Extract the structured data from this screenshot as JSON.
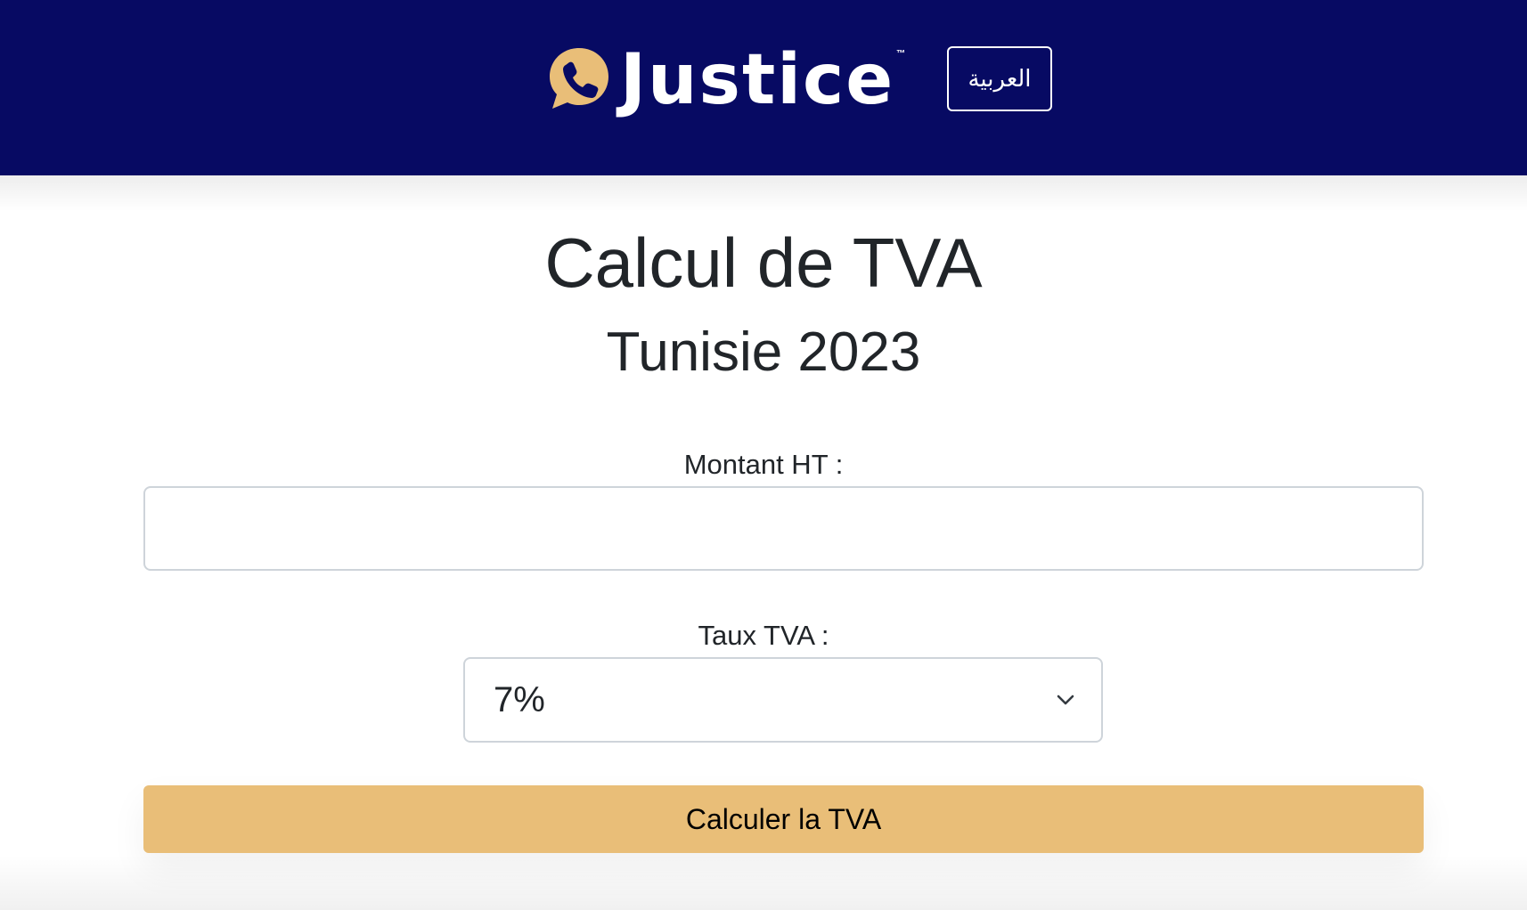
{
  "header": {
    "brand_name": "Justice",
    "trademark": "™",
    "language_button": "العربية",
    "colors": {
      "background": "#070a63",
      "logo_accent": "#e9be78",
      "text": "#ffffff"
    }
  },
  "main": {
    "title": "Calcul de TVA",
    "subtitle": "Tunisie 2023",
    "amount_label": "Montant HT :",
    "amount_value": "",
    "amount_placeholder": "",
    "rate_label": "Taux TVA :",
    "rate_selected": "7%",
    "submit_label": "Calculer la TVA",
    "colors": {
      "button": "#e9be78",
      "text": "#212529"
    }
  },
  "icons": {
    "logo": "phone-chat-bubble-icon",
    "select_arrow": "chevron-down-icon"
  }
}
